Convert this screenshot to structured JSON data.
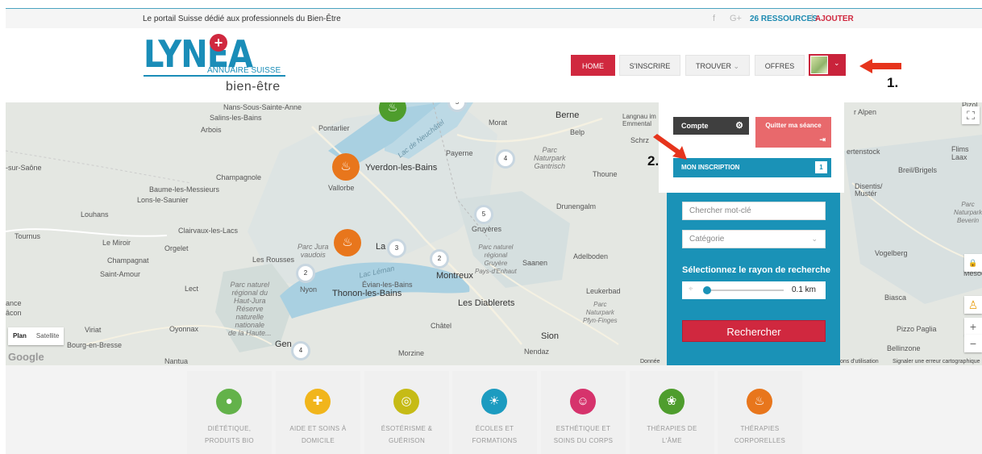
{
  "topbar": {
    "tagline": "Le portail Suisse dédié aux professionnels du Bien-Être",
    "facebook_icon": "f",
    "gplus_icon": "G+",
    "resources": "26 RESSOURCES",
    "separator": "|",
    "add": "AJOUTER"
  },
  "logo": {
    "name": "LYNEA",
    "cross": "+",
    "annuaire": "ANNUAIRE SUISSE",
    "bien": "bien-être"
  },
  "nav": {
    "home": "HOME",
    "inscrire": "S'INSCRIRE",
    "trouver": "TROUVER",
    "offres": "OFFRES",
    "chevron": "⌄",
    "dropdown_chevron": "⌄"
  },
  "annotations": {
    "step1": "1.",
    "step2": "2."
  },
  "map": {
    "labels": {
      "nans": "Nans-Sous-Sainte-Anne",
      "salins": "Salins-les-Bains",
      "arbois": "Arbois",
      "pontarlier": "Pontarlier",
      "morat": "Morat",
      "berne": "Berne",
      "langnau": "Langnau im\nEmmental",
      "belp": "Belp",
      "payerne": "Payerne",
      "parc_gantrisch": "Parc\nNaturpark\nGantrisch",
      "schrz": "Schrz",
      "sur_saone": "-sur-Saône",
      "champagnole": "Champagnole",
      "yverdon": "Yverdon-les-Bains",
      "baume": "Baume-les-Messieurs",
      "lons": "Lons-le-Saunier",
      "vallorbe": "Vallorbe",
      "thoune": "Thoune",
      "louhans": "Louhans",
      "drunengalm": "Drunengalm",
      "clairvaux": "Clairvaux-les-Lacs",
      "gruyeres": "Gruyères",
      "tournus": "Tournus",
      "le_miroir": "Le Miroir",
      "orgelet": "Orgelet",
      "parc_jura": "Parc Jura\nvaudois",
      "parc_gruyere": "Parc naturel\nrégional\nGruyère\nPays-d'Enhaut",
      "adelboden": "Adelboden",
      "champagnat": "Champagnat",
      "les_rousses": "Les Rousses",
      "saanen": "Saanen",
      "saint_amour": "Saint-Amour",
      "lect": "Lect",
      "parc_haut_jura": "Parc naturel\nrégional du\nHaut-Jura\nRéserve\nnaturelle\nnationale\nde la Haute...",
      "nyon": "Nyon",
      "thonon": "Thonon-les-Bains",
      "evian": "Évian-les-Bains",
      "montreux": "Montreux",
      "leukerbad": "Leukerbad",
      "diablerets": "Les Diablerets",
      "parc_pfyn": "Parc\nNaturpark\nPfyn-Finges",
      "macon": "âcon",
      "oyonnax": "Oyonnax",
      "viriat": "Viriat",
      "chatel": "Châtel",
      "sion": "Sion",
      "bourg": "Bourg-en-Bresse",
      "gen": "Gen",
      "nendaz": "Nendaz",
      "morzine": "Morzine",
      "nantua": "Nantua",
      "ance": "ance",
      "la": "La",
      "lac_neuchatel": "Lac de Neuchâtel",
      "lac_leman": "Lac Léman",
      "r_alpen": "r Alpen",
      "pizol": "Pizol",
      "ertenstock": "ertenstock",
      "flims": "Flims\nLaax",
      "breil": "Breil/Brigels",
      "disentis": "Disentis/\nMustér",
      "parc_beverin": "Parc\nNaturpark\nBeverin",
      "vogelberg": "Vogelberg",
      "mesocl": "Mesocl",
      "biasca": "Biasca",
      "pizzo_paglia": "Pizzo Paglia",
      "bellinzone": "Bellinzone"
    },
    "clusters": [
      "4",
      "5",
      "3",
      "2",
      "2",
      "4",
      "5"
    ],
    "pin_icon": "♨",
    "tab_plan": "Plan",
    "tab_satellite": "Satellite",
    "google": "Google",
    "fullscreen_icon": "⛶",
    "zoom_in": "+",
    "zoom_out": "−",
    "lock_icon": "🔒",
    "pegman_icon": "♙",
    "footer_donnees": "Donnée",
    "footer_conditions": "ons d'utilisation",
    "footer_report": "Signaler une erreur cartographique"
  },
  "panel": {
    "compte": "Compte",
    "gear": "⚙",
    "quitter": "Quitter ma séance",
    "quit_icon": "⇥",
    "inscription": "MON INSCRIPTION",
    "inscription_count": "1"
  },
  "search": {
    "keyword_placeholder": "Chercher mot-clé",
    "category": "Catégorie",
    "category_chevron": "⌄",
    "radius_label": "Sélectionnez le rayon de recherche",
    "target_icon": "⌖",
    "radius_value": "0.1 km",
    "radius_fraction": 0,
    "submit": "Rechercher"
  },
  "categories": [
    {
      "label": "DIÉTÉTIQUE,\nPRODUITS BIO",
      "icon": "apple-icon",
      "glyph": "●",
      "color": "#63b24a"
    },
    {
      "label": "AIDE ET SOINS À\nDOMICILE",
      "icon": "first-aid-icon",
      "glyph": "✚",
      "color": "#f1b51b"
    },
    {
      "label": "ÉSOTÉRISME &\nGUÉRISON",
      "icon": "spiral-icon",
      "glyph": "◎",
      "color": "#c6bb16"
    },
    {
      "label": "ÉCOLES ET\nFORMATIONS",
      "icon": "lightbulb-icon",
      "glyph": "☀",
      "color": "#1c9bc0"
    },
    {
      "label": "ESTHÉTIQUE ET\nSOINS DU CORPS",
      "icon": "face-icon",
      "glyph": "☺",
      "color": "#d6336c"
    },
    {
      "label": "THÉRAPIES DE\nL'ÂME",
      "icon": "lotus-icon",
      "glyph": "❀",
      "color": "#4e9d2d"
    },
    {
      "label": "THÉRAPIES\nCORPORELLES",
      "icon": "hand-icon",
      "glyph": "♨",
      "color": "#e8761c"
    }
  ]
}
